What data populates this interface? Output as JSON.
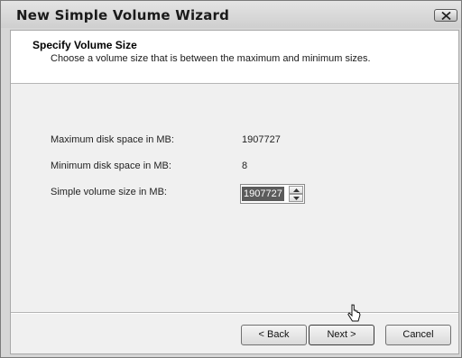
{
  "window": {
    "title": "New Simple Volume Wizard"
  },
  "header": {
    "title": "Specify Volume Size",
    "subtitle": "Choose a volume size that is between the maximum and minimum sizes."
  },
  "fields": {
    "max_label": "Maximum disk space in MB:",
    "max_value": "1907727",
    "min_label": "Minimum disk space in MB:",
    "min_value": "8",
    "size_label": "Simple volume size in MB:",
    "size_value": "1907727"
  },
  "buttons": {
    "back": "< Back",
    "next": "Next >",
    "cancel": "Cancel"
  },
  "icons": {
    "close": "close-icon",
    "spin_up": "arrow-up-icon",
    "spin_down": "arrow-down-icon",
    "cursor": "mouse-pointer-icon"
  },
  "colors": {
    "selection": "#5b5b5b",
    "header_bg": "#ffffff",
    "body_bg": "#f0f0f0"
  }
}
